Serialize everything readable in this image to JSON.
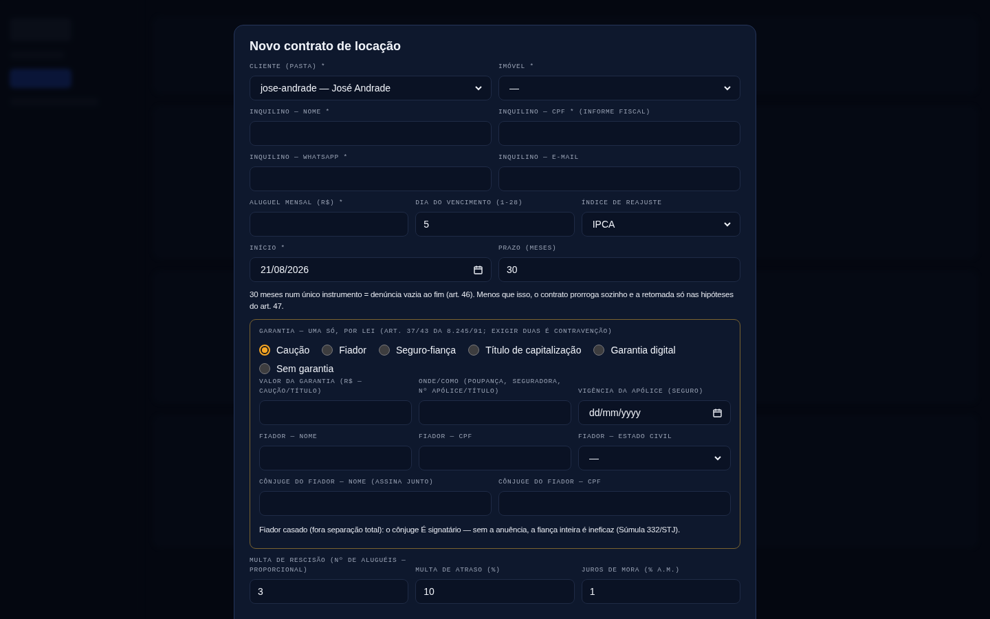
{
  "modal": {
    "title": "Novo contrato de locação",
    "rows": [
      [
        {
          "label": "CLIENTE (PASTA) *",
          "kind": "select",
          "value": "jose-andrade — José Andrade"
        },
        {
          "label": "IMÓVEL *",
          "kind": "select",
          "value": "—"
        }
      ],
      [
        {
          "label": "INQUILINO — NOME *",
          "kind": "text"
        },
        {
          "label": "INQUILINO — CPF * (INFORME FISCAL)",
          "kind": "text"
        }
      ],
      [
        {
          "label": "INQUILINO — WHATSAPP *",
          "kind": "text"
        },
        {
          "label": "INQUILINO — E-MAIL",
          "kind": "text"
        }
      ],
      [
        {
          "label": "ALUGUEL MENSAL (R$) *",
          "kind": "text"
        },
        {
          "label": "DIA DO VENCIMENTO (1-28)",
          "kind": "text",
          "value": "5"
        },
        {
          "label": "ÍNDICE DE REAJUSTE",
          "kind": "select",
          "value": "IPCA"
        }
      ],
      [
        {
          "label": "INÍCIO *",
          "kind": "date",
          "value": "21/08/2026"
        },
        {
          "label": "PRAZO (MESES)",
          "kind": "text",
          "value": "30"
        }
      ]
    ],
    "note": "30 meses num único instrumento = denúncia vazia ao fim (art. 46). Menos que isso, o contrato prorroga sozinho e a retomada só nas hipóteses do art. 47.",
    "guarantee": {
      "label": "GARANTIA — UMA SÓ, POR LEI (ART. 37/43 DA 8.245/91; EXIGIR DUAS É CONTRAVENÇÃO)",
      "options": [
        {
          "label": "Caução",
          "selected": true
        },
        {
          "label": "Fiador",
          "selected": false
        },
        {
          "label": "Seguro-fiança",
          "selected": false
        },
        {
          "label": "Título de capitalização",
          "selected": false
        },
        {
          "label": "Garantia digital",
          "selected": false
        },
        {
          "label": "Sem garantia",
          "selected": false
        }
      ],
      "rows": [
        [
          {
            "label": "VALOR DA GARANTIA (R$ — CAUÇÃO/TÍTULO)",
            "kind": "text"
          },
          {
            "label": "ONDE/COMO (POUPANÇA, SEGURADORA, Nº APÓLICE/TÍTULO)",
            "kind": "text"
          },
          {
            "label": "VIGÊNCIA DA APÓLICE (SEGURO)",
            "kind": "date",
            "placeholder": "dd/mm/yyyy"
          }
        ],
        [
          {
            "label": "FIADOR — NOME",
            "kind": "text"
          },
          {
            "label": "FIADOR — CPF",
            "kind": "text"
          },
          {
            "label": "FIADOR — ESTADO CIVIL",
            "kind": "select",
            "value": "—"
          }
        ],
        [
          {
            "label": "CÔNJUGE DO FIADOR — NOME (ASSINA JUNTO)",
            "kind": "text"
          },
          {
            "label": "CÔNJUGE DO FIADOR — CPF",
            "kind": "text"
          }
        ]
      ],
      "note": "Fiador casado (fora separação total): o cônjuge É signatário — sem a anuência, a fiança inteira é ineficaz (Súmula 332/STJ)."
    },
    "bottom_rows": [
      [
        {
          "label": "MULTA DE RESCISÃO (Nº DE ALUGUÉIS — PROPORCIONAL)",
          "kind": "text",
          "value": "3"
        },
        {
          "label": "MULTA DE ATRASO (%)",
          "kind": "text",
          "value": "10"
        },
        {
          "label": "JUROS DE MORA (% A.M.)",
          "kind": "text",
          "value": "1"
        }
      ]
    ]
  }
}
